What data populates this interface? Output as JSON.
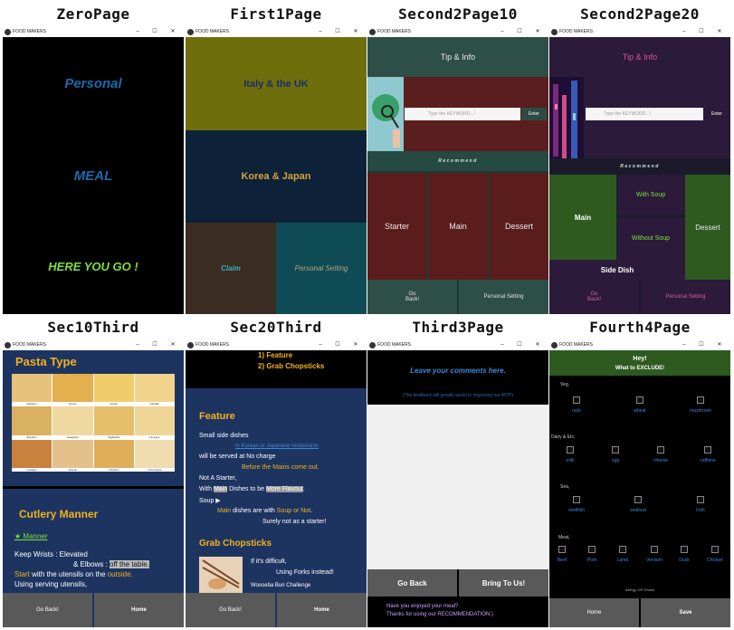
{
  "app_name": "FOOD MAKERS",
  "window_controls": {
    "minimize": "–",
    "maximize": "☐",
    "close": "✕"
  },
  "titles": [
    "ZeroPage",
    "First1Page",
    "Second2Page10",
    "Second2Page20",
    "Sec10Third",
    "Sec20Third",
    "Third3Page",
    "Fourth4Page"
  ],
  "zero": {
    "line1": "Personal",
    "line2": "MEAL",
    "line3": "HERE YOU GO !"
  },
  "first": {
    "italy": "Italy & the UK",
    "korea": "Korea & Japan",
    "claim": "Claim",
    "personal": "Personal Setting"
  },
  "s210": {
    "tip": "Tip & Info",
    "placeholder": "Type the KEYWORD...!",
    "enter": "Enter",
    "recommend": "Recommend",
    "starter": "Starter",
    "main": "Main",
    "dessert": "Dessert",
    "back": "Go Back!",
    "setting": "Personal Setting"
  },
  "s220": {
    "tip": "Tip & Info",
    "placeholder": "Type the KEYWORD...!",
    "enter": "Enter",
    "recommend": "Recommend",
    "main": "Main",
    "with_soup": "With Soup",
    "without_soup": "Without Soup",
    "dessert": "Dessert",
    "side": "Side  Dish",
    "back": "Go Back!",
    "setting": "Personal Setting"
  },
  "sec10": {
    "pasta_title": "Pasta Type",
    "pastas": [
      "Rigatoni",
      "Penne",
      "Fusilli",
      "Farfalle",
      "Bucatini",
      "Spaghetti",
      "Tagliatelle",
      "Linguine",
      "Lasagne",
      "Ravioli",
      "Tortellini",
      "Orecchiette"
    ],
    "cutlery": "Cutlery Manner",
    "manner_link": "★ Manner",
    "keep": "Keep Wrists : Elevated",
    "elbows": "& Elbows : ",
    "off_table": "off the table.",
    "start": "Start",
    "start_rest": " with the utensils on the ",
    "outside": "outside.",
    "using": "Using serving utensils,",
    "back": "Go Back!",
    "home": "Home"
  },
  "sec20": {
    "feature1": "1) Feature",
    "feature2": "2) Grab Chopsticks",
    "feature": "Feature",
    "small": "Small side dishes",
    "korean": "in Korean or Japanese restaurants",
    "served": "will be served at No charge",
    "before": "Before the Mains come out.",
    "not_starter": "Not A Starter,",
    "with": "With ",
    "main_hl": "Main",
    "dishes": " Dishes to be ",
    "more_flavour": "More Flavour",
    "period": ".",
    "soup": "Soup ▶",
    "main_txt": "Main",
    "dishes_are": " dishes are with ",
    "soup_or_not": "Soup or Not",
    "period2": ".",
    "surely": "Surely not as a starter!",
    "grab": "Grab Chopsticks",
    "difficult": "If it's difficult,",
    "forks": "Using Forks instead!",
    "challenge": "Wooseba Buri Challenge",
    "back": "Go Back!",
    "home": "Home"
  },
  "third": {
    "leave": "Leave your comments here.",
    "feedback": "(The feedback will greatly assist in improving our APP!)",
    "back": "Go Back",
    "bring": "Bring To Us!",
    "enjoyed": "Have you enjoyed your meal?",
    "thanks": "Thanks for using our RECOMMENDATION:)"
  },
  "fourth": {
    "hey": "Hey!",
    "what": "What to EXCLUDE!",
    "veg": "Veg,",
    "veg_items": [
      "nuts",
      "wheat",
      "mushroom"
    ],
    "dairy": "Dairy & Etc,",
    "dairy_items": [
      "milk",
      "egg",
      "cheese",
      "caffeine"
    ],
    "sea": "Sea,",
    "sea_items": [
      "shellfish",
      "seafood",
      "Fish"
    ],
    "meat": "Meat,",
    "meat_items": [
      "Beef",
      "Pork",
      "Lamb",
      "Venison",
      "Duck",
      "Chicken"
    ],
    "allergy": "Allergy OR Dislike",
    "home": "Home",
    "save": "Save"
  }
}
